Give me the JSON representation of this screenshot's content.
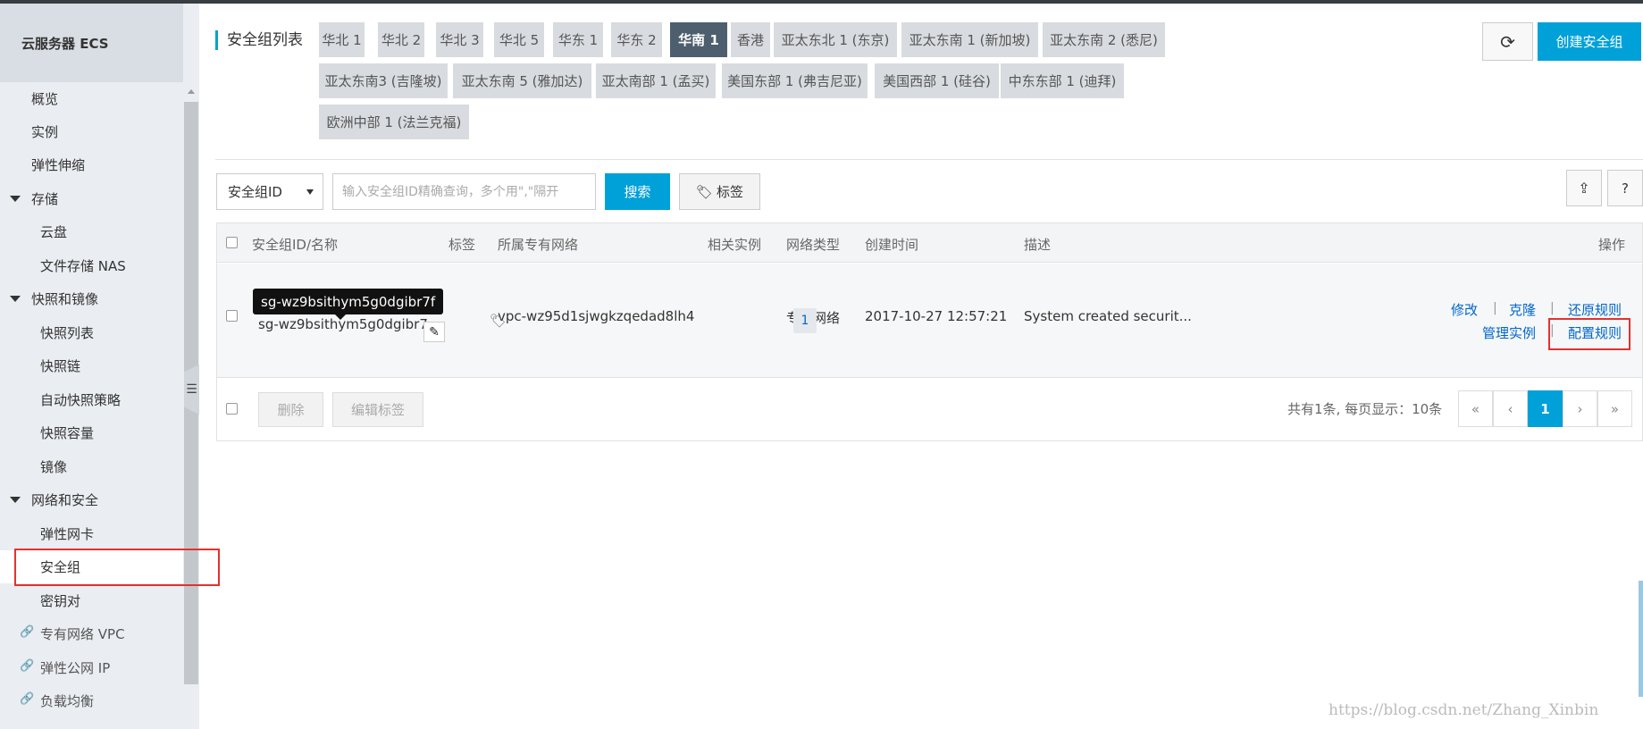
{
  "sidebar": {
    "title": "云服务器 ECS",
    "items": [
      {
        "label": "概览",
        "kind": "l1"
      },
      {
        "label": "实例",
        "kind": "l1"
      },
      {
        "label": "弹性伸缩",
        "kind": "l1"
      },
      {
        "label": "存储",
        "kind": "group"
      },
      {
        "label": "云盘",
        "kind": "l2"
      },
      {
        "label": "文件存储 NAS",
        "kind": "l2"
      },
      {
        "label": "快照和镜像",
        "kind": "group"
      },
      {
        "label": "快照列表",
        "kind": "l2"
      },
      {
        "label": "快照链",
        "kind": "l2"
      },
      {
        "label": "自动快照策略",
        "kind": "l2"
      },
      {
        "label": "快照容量",
        "kind": "l2"
      },
      {
        "label": "镜像",
        "kind": "l2"
      },
      {
        "label": "网络和安全",
        "kind": "group"
      },
      {
        "label": "弹性网卡",
        "kind": "l2"
      },
      {
        "label": "安全组",
        "kind": "l2",
        "active": true
      },
      {
        "label": "密钥对",
        "kind": "l2"
      },
      {
        "label": "专有网络 VPC",
        "kind": "link"
      },
      {
        "label": "弹性公网 IP",
        "kind": "link"
      },
      {
        "label": "负载均衡",
        "kind": "link"
      }
    ]
  },
  "header": {
    "title": "安全组列表",
    "regions": [
      "华北 1",
      "华北 2",
      "华北 3",
      "华北 5",
      "华东 1",
      "华东 2",
      "华南 1",
      "香港",
      "亚太东北 1 (东京)",
      "亚太东南 1 (新加坡)",
      "亚太东南 2 (悉尼)",
      "亚太东南3 (吉隆坡)",
      "亚太东南 5 (雅加达)",
      "亚太南部 1 (孟买)",
      "美国东部 1 (弗吉尼亚)",
      "美国西部 1 (硅谷)",
      "中东东部 1 (迪拜)",
      "欧洲中部 1 (法兰克福)"
    ],
    "active_region": "华南 1",
    "refresh_icon": "refresh-icon",
    "create_label": "创建安全组"
  },
  "filter": {
    "select_value": "安全组ID",
    "search_placeholder": "输入安全组ID精确查询，多个用\",\"隔开",
    "search_label": "搜索",
    "tag_label": "标签",
    "help_label": "?"
  },
  "table": {
    "columns": [
      "安全组ID/名称",
      "标签",
      "所属专有网络",
      "相关实例",
      "网络类型",
      "创建时间",
      "描述",
      "操作"
    ],
    "row": {
      "id": "sg-wz9bsithym5g0dgibr7f",
      "id_line1": "sg-wz9bsithym5g0dgibr7f",
      "name": "sg-wz9bsithym5g0dgibr7...",
      "vpc": "vpc-wz95d1sjwgkzqedad8lh4",
      "instances": "1",
      "network_type": "专有网络",
      "created": "2017-10-27 12:57:21",
      "description": "System created securit...",
      "ops": [
        "修改",
        "克隆",
        "还原规则",
        "管理实例",
        "配置规则"
      ]
    },
    "footer": {
      "delete_label": "删除",
      "edit_tags_label": "编辑标签",
      "summary": "共有1条, 每页显示：10条",
      "pages": [
        "«",
        "‹",
        "1",
        "›",
        "»"
      ]
    }
  },
  "tooltip": "sg-wz9bsithym5g0dgibr7f",
  "watermark": "https://blog.csdn.net/Zhang_Xinbin",
  "colors": {
    "accent": "#00a0d8",
    "active_region": "#4d5e6e",
    "highlight": "#e3312f"
  }
}
